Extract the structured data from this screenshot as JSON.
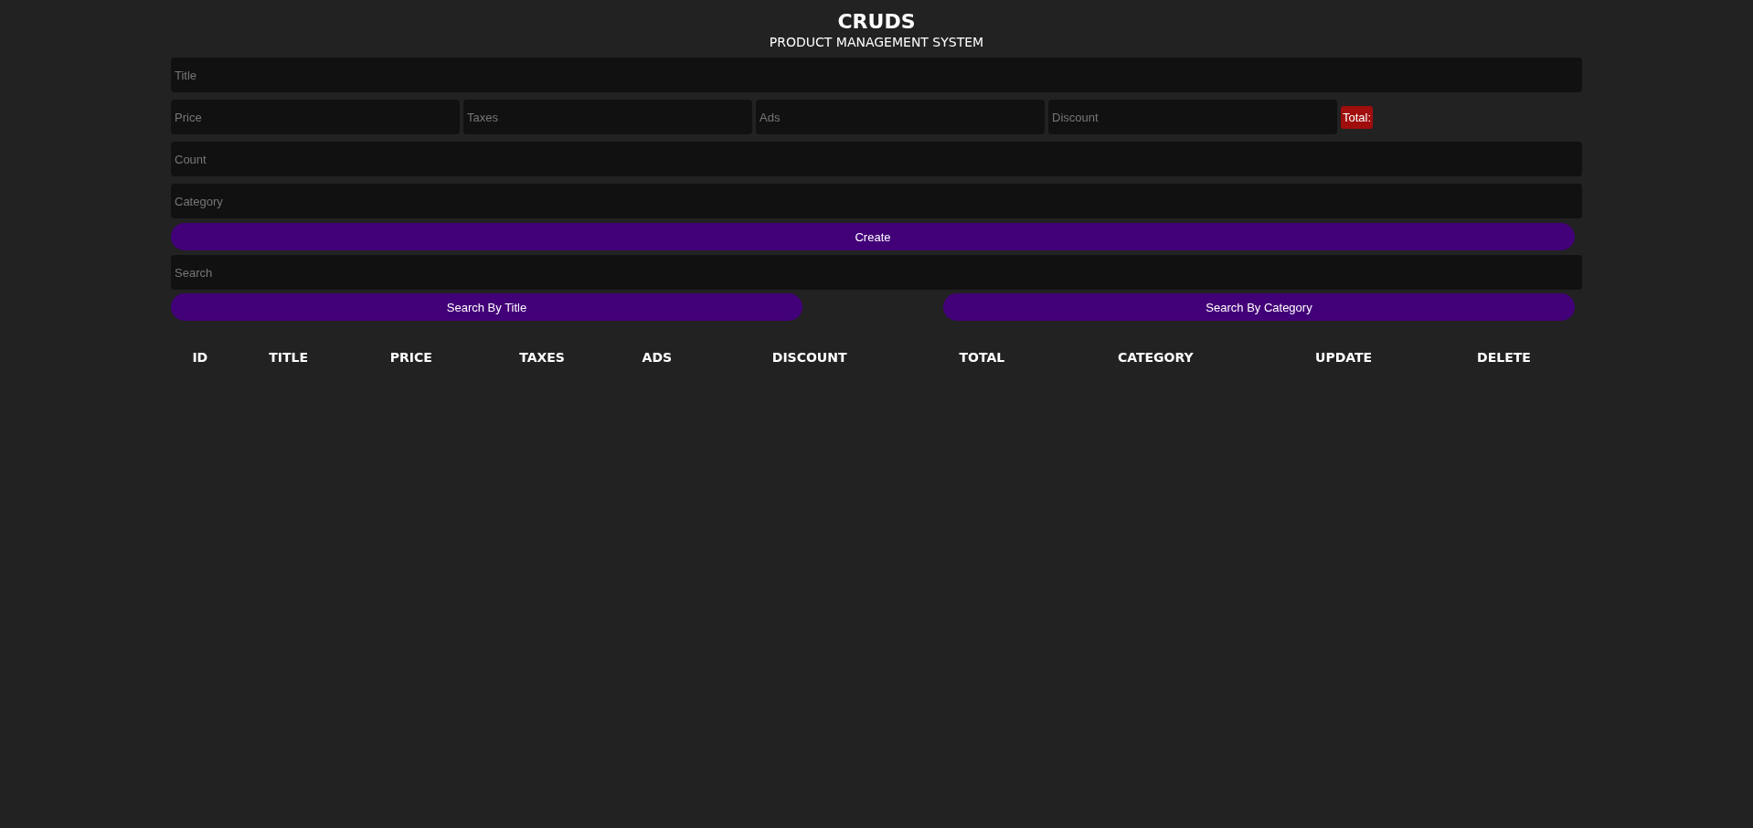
{
  "header": {
    "title": "CRUDS",
    "subtitle": "PRODUCT MANAGEMENT SYSTEM"
  },
  "form": {
    "title": {
      "placeholder": "Title"
    },
    "price_fields": [
      {
        "placeholder": "Price"
      },
      {
        "placeholder": "Taxes"
      },
      {
        "placeholder": "Ads"
      },
      {
        "placeholder": "Discount"
      }
    ],
    "total": "Total:",
    "count": {
      "placeholder": "Count"
    },
    "category": {
      "placeholder": "Category"
    },
    "create_button": "Create"
  },
  "search": {
    "placeholder": "Search"
  },
  "search_buttons": [
    "Search By Title",
    "Search By Category"
  ],
  "table": {
    "columns": [
      "ID",
      "TITLE",
      "PRICE",
      "TAXES",
      "ADS",
      "DISCOUNT",
      "TOTAL",
      "CATEGORY",
      "UPDATE",
      "DELETE"
    ]
  }
}
